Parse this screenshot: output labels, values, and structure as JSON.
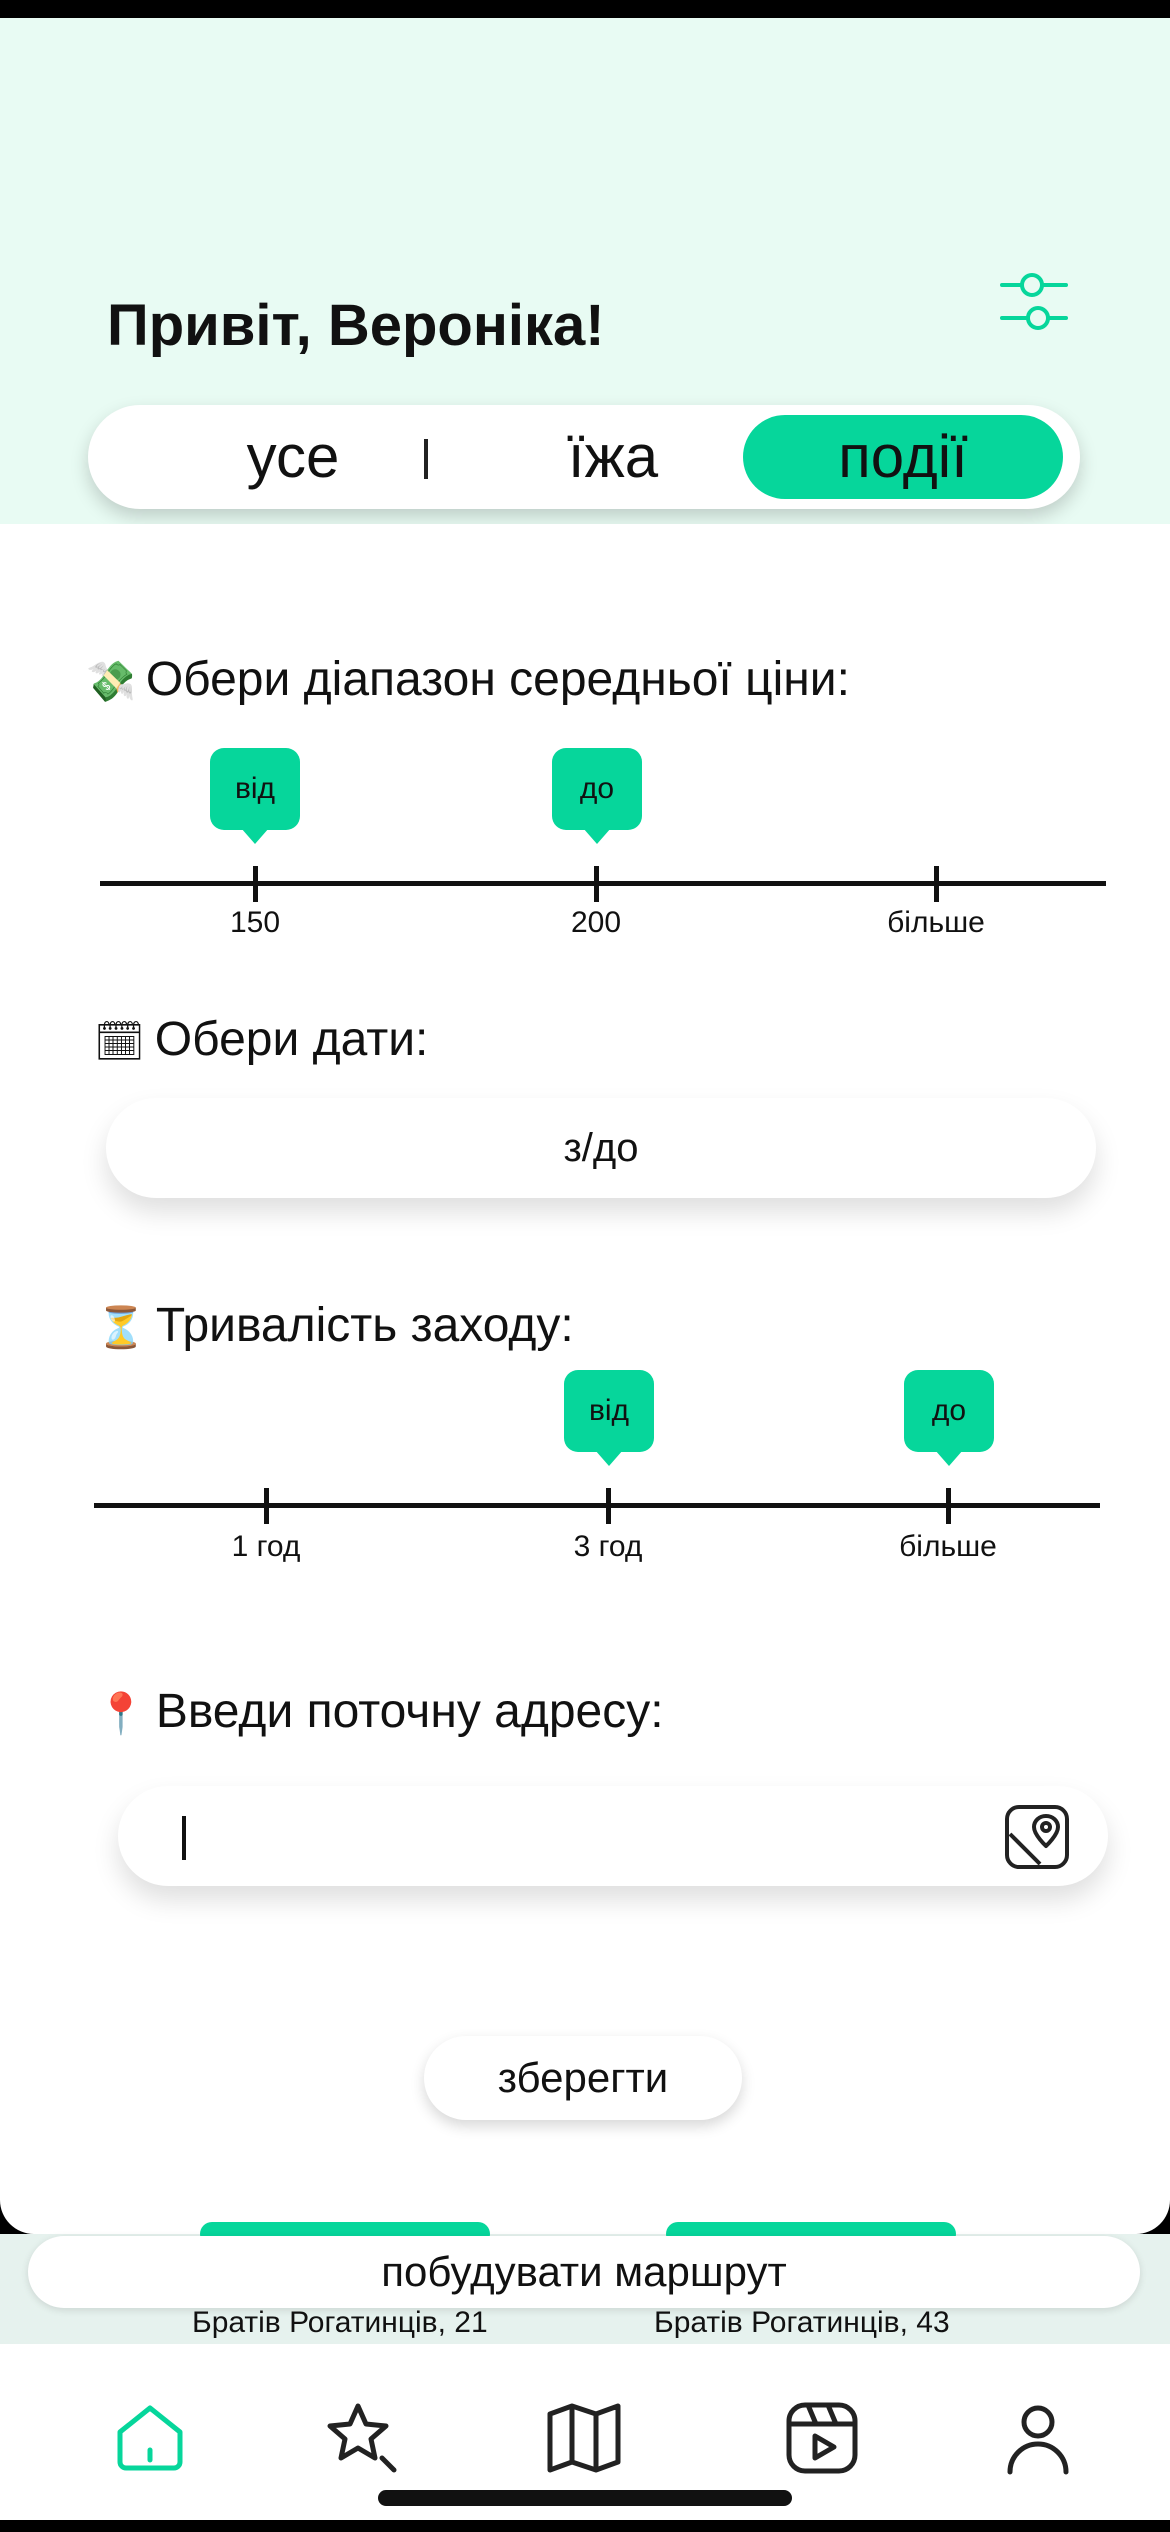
{
  "header": {
    "greeting": "Привіт, Вероніка!",
    "filter_icon": "sliders-icon"
  },
  "tabs": [
    {
      "label": "усе",
      "selected": false
    },
    {
      "label": "їжа",
      "selected": false
    },
    {
      "label": "події",
      "selected": true
    }
  ],
  "accent_color": "#06d69b",
  "price": {
    "emoji": "💸",
    "title": "Обери діапазон середньої ціни:",
    "ticks": [
      "150",
      "200",
      "більше"
    ],
    "from_label": "від",
    "to_label": "до",
    "from_value": "150",
    "to_value": "200"
  },
  "dates": {
    "emoji": "🗓",
    "title": "Обери дати:",
    "value": "з/до"
  },
  "duration": {
    "emoji": "⏳",
    "title": "Тривалість заходу:",
    "ticks": [
      "1 год",
      "3 год",
      "більше"
    ],
    "from_label": "від",
    "to_label": "до",
    "from_value": "3 год",
    "to_value": "більше"
  },
  "address": {
    "emoji": "📍",
    "title": "Введи поточну адресу:",
    "value": "",
    "map_icon": "map-pin-icon"
  },
  "save_label": "зберегти",
  "route": {
    "label": "побудувати маршрут",
    "addresses": [
      "Братів Рогатинців, 21",
      "Братів Рогатинців, 43"
    ]
  },
  "nav": [
    "home-icon",
    "star-icon",
    "map-icon",
    "reels-icon",
    "profile-icon"
  ]
}
